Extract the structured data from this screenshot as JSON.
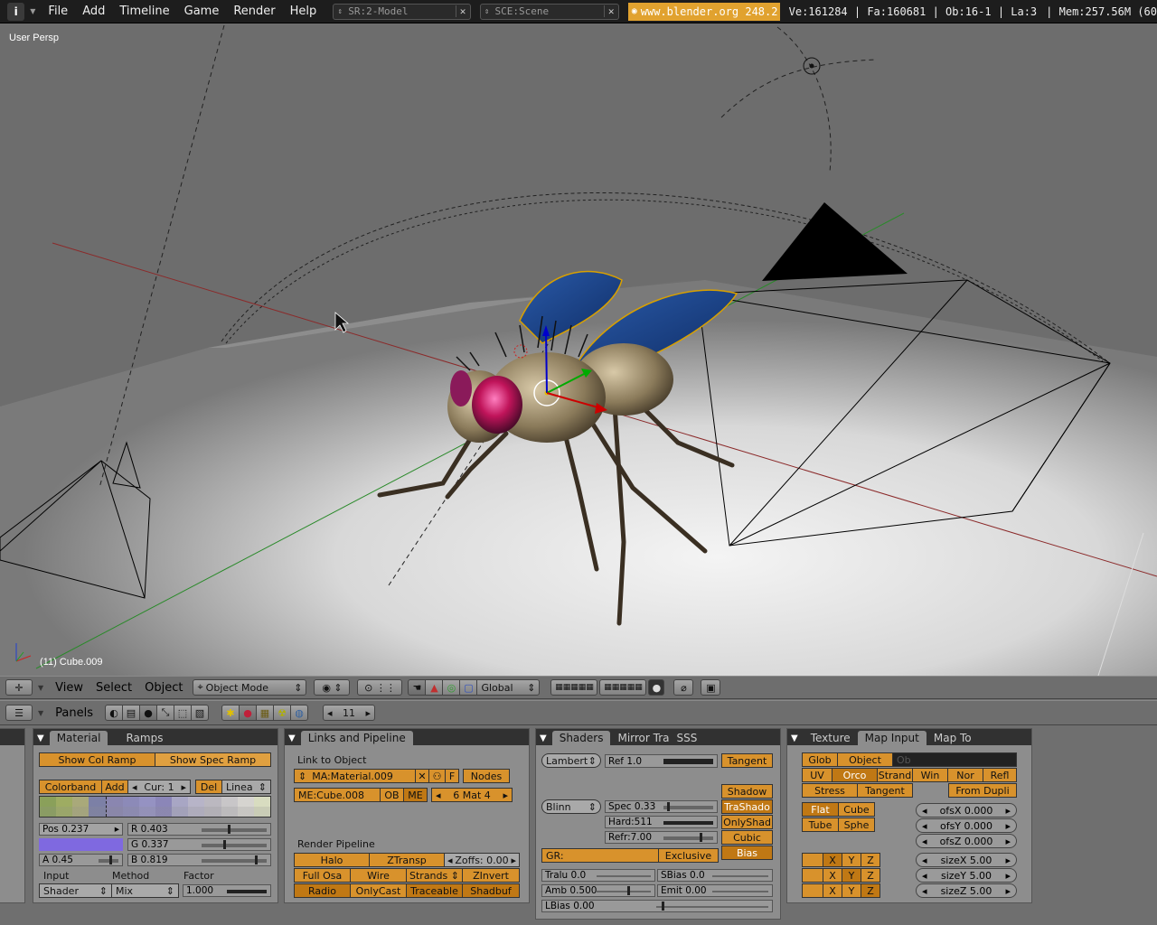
{
  "topbar": {
    "menus": [
      "File",
      "Add",
      "Timeline",
      "Game",
      "Render",
      "Help"
    ],
    "screen": "SR:2-Model",
    "scene": "SCE:Scene",
    "url": "www.blender.org 248.2",
    "stats": "Ve:161284 | Fa:160681 | Ob:16-1 | La:3",
    "mem": "| Mem:257.56M (60"
  },
  "viewport": {
    "view_name": "User Persp",
    "object_label": "(11) Cube.009"
  },
  "view3d_header": {
    "menus": [
      "View",
      "Select",
      "Object"
    ],
    "mode": "Object Mode",
    "orientation": "Global"
  },
  "buttons_header": {
    "panels_label": "Panels",
    "frame": "11"
  },
  "material_panel": {
    "tabs": [
      "Material",
      "Ramps"
    ],
    "show_col_ramp": "Show Col Ramp",
    "show_spec_ramp": "Show Spec Ramp",
    "colorband": "Colorband",
    "add": "Add",
    "cur": "Cur: 1",
    "del": "Del",
    "interp": "Linea",
    "pos": "Pos 0.237",
    "r": "R 0.403",
    "g": "G 0.337",
    "b": "B 0.819",
    "a": "A 0.45",
    "input_label": "Input",
    "method_label": "Method",
    "factor_label": "Factor",
    "input": "Shader",
    "method": "Mix",
    "factor": "1.000",
    "swatch_color": "#7f69e0",
    "ramp_colors": [
      "#8aa05a",
      "#9eac62",
      "#a9a97a",
      "#7c80a6",
      "#8a86b0",
      "#8c8ab8",
      "#9592c2",
      "#8b86b8",
      "#a8a6c4",
      "#b7b4c8",
      "#bbb8c0",
      "#c8c6c8",
      "#d6d4d0",
      "#d8dcc0"
    ]
  },
  "links_panel": {
    "title": "Links and Pipeline",
    "link_to_object": "Link to Object",
    "material": "MA:Material.009",
    "f": "F",
    "nodes": "Nodes",
    "mesh": "ME:Cube.008",
    "ob": "OB",
    "me": "ME",
    "mat": "6 Mat 4",
    "render_pipeline": "Render Pipeline",
    "halo": "Halo",
    "ztransp": "ZTransp",
    "zoffs": "Zoffs: 0.00",
    "full_osa": "Full Osa",
    "wire": "Wire",
    "strands": "Strands",
    "zinvert": "ZInvert",
    "radio": "Radio",
    "onlycast": "OnlyCast",
    "traceable": "Traceable",
    "shadbuf": "Shadbuf"
  },
  "shaders_panel": {
    "tabs": [
      "Shaders",
      "Mirror Tra",
      "SSS"
    ],
    "diffuse": "Lambert",
    "ref": "Ref   1.0",
    "tangent": "Tangent",
    "shadow": "Shadow",
    "trashado": "TraShado",
    "onlyshad": "OnlyShad",
    "cubic": "Cubic",
    "bias": "Bias",
    "specular": "Blinn",
    "spec": "Spec 0.33",
    "hard": "Hard:511",
    "refr": "Refr:7.00",
    "gr": "GR:",
    "exclusive": "Exclusive",
    "tralu": "Tralu 0.0",
    "sbias": "SBias 0.0",
    "amb": "Amb 0.500",
    "emit": "Emit 0.00",
    "lbias": "LBias 0.00"
  },
  "texture_panel": {
    "tabs": [
      "Texture",
      "Map Input",
      "Map To"
    ],
    "glob": "Glob",
    "object": "Object",
    "ob_field": "Ob",
    "uv": "UV",
    "orco": "Orco",
    "strand": "Strand",
    "win": "Win",
    "nor": "Nor",
    "refl": "Refl",
    "stress": "Stress",
    "tangent": "Tangent",
    "from_dupli": "From Dupli",
    "flat": "Flat",
    "cube": "Cube",
    "tube": "Tube",
    "sphe": "Sphe",
    "ofsx": "ofsX 0.000",
    "ofsy": "ofsY 0.000",
    "ofsz": "ofsZ 0.000",
    "sizex": "sizeX 5.00",
    "sizey": "sizeY 5.00",
    "sizez": "sizeZ 5.00",
    "x": "X",
    "y": "Y",
    "z": "Z"
  }
}
